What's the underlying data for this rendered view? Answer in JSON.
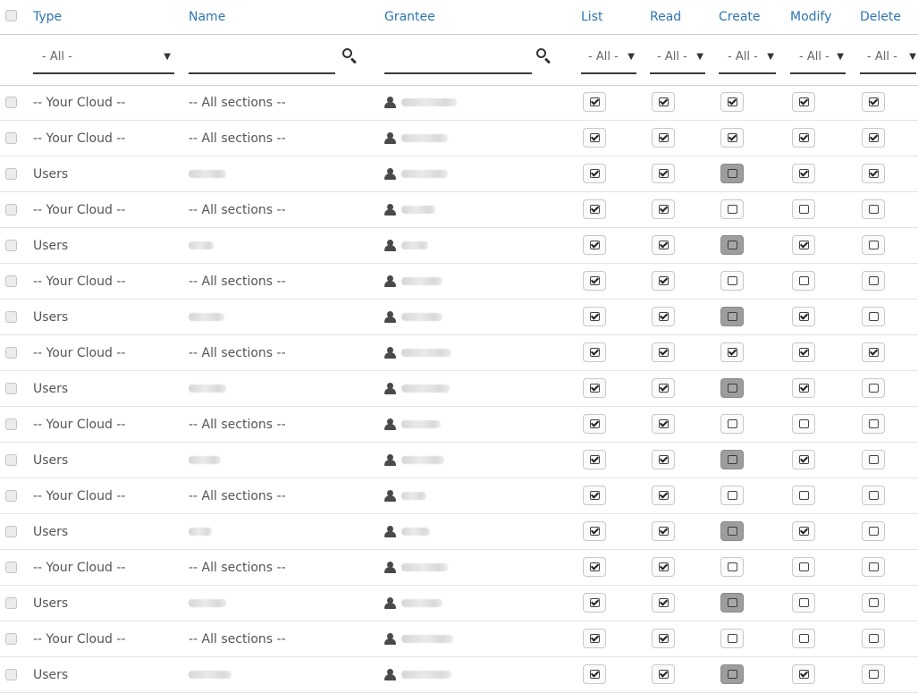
{
  "headers": {
    "type": "Type",
    "name": "Name",
    "grantee": "Grantee",
    "list": "List",
    "read": "Read",
    "create": "Create",
    "modify": "Modify",
    "delete": "Delete"
  },
  "filters": {
    "type_value": "- All -",
    "list_value": "- All -",
    "read_value": "- All -",
    "create_value": "- All -",
    "modify_value": "- All -",
    "delete_value": "- All -",
    "name_search_placeholder": "",
    "grantee_search_placeholder": ""
  },
  "rows": [
    {
      "type": "-- Your Cloud --",
      "name": "-- All sections --",
      "grantee": "",
      "list": true,
      "read": true,
      "create": true,
      "modify": true,
      "delete": true,
      "create_disabled": false
    },
    {
      "type": "-- Your Cloud --",
      "name": "-- All sections --",
      "grantee": "",
      "list": true,
      "read": true,
      "create": true,
      "modify": true,
      "delete": true,
      "create_disabled": false
    },
    {
      "type": "Users",
      "name": "",
      "grantee": "",
      "list": true,
      "read": true,
      "create": false,
      "modify": true,
      "delete": true,
      "create_disabled": true
    },
    {
      "type": "-- Your Cloud --",
      "name": "-- All sections --",
      "grantee": "",
      "list": true,
      "read": true,
      "create": false,
      "modify": false,
      "delete": false,
      "create_disabled": false
    },
    {
      "type": "Users",
      "name": "",
      "grantee": "",
      "list": true,
      "read": true,
      "create": false,
      "modify": true,
      "delete": false,
      "create_disabled": true
    },
    {
      "type": "-- Your Cloud --",
      "name": "-- All sections --",
      "grantee": "",
      "list": true,
      "read": true,
      "create": false,
      "modify": false,
      "delete": false,
      "create_disabled": false
    },
    {
      "type": "Users",
      "name": "",
      "grantee": "",
      "list": true,
      "read": true,
      "create": false,
      "modify": true,
      "delete": false,
      "create_disabled": true
    },
    {
      "type": "-- Your Cloud --",
      "name": "-- All sections --",
      "grantee": "",
      "list": true,
      "read": true,
      "create": true,
      "modify": true,
      "delete": true,
      "create_disabled": false
    },
    {
      "type": "Users",
      "name": "",
      "grantee": "",
      "list": true,
      "read": true,
      "create": false,
      "modify": true,
      "delete": false,
      "create_disabled": true
    },
    {
      "type": "-- Your Cloud --",
      "name": "-- All sections --",
      "grantee": "",
      "list": true,
      "read": true,
      "create": false,
      "modify": false,
      "delete": false,
      "create_disabled": false
    },
    {
      "type": "Users",
      "name": "",
      "grantee": "",
      "list": true,
      "read": true,
      "create": false,
      "modify": true,
      "delete": false,
      "create_disabled": true
    },
    {
      "type": "-- Your Cloud --",
      "name": "-- All sections --",
      "grantee": "",
      "list": true,
      "read": true,
      "create": false,
      "modify": false,
      "delete": false,
      "create_disabled": false
    },
    {
      "type": "Users",
      "name": "",
      "grantee": "",
      "list": true,
      "read": true,
      "create": false,
      "modify": true,
      "delete": false,
      "create_disabled": true
    },
    {
      "type": "-- Your Cloud --",
      "name": "-- All sections --",
      "grantee": "",
      "list": true,
      "read": true,
      "create": false,
      "modify": false,
      "delete": false,
      "create_disabled": false
    },
    {
      "type": "Users",
      "name": "",
      "grantee": "",
      "list": true,
      "read": true,
      "create": false,
      "modify": false,
      "delete": false,
      "create_disabled": true
    },
    {
      "type": "-- Your Cloud --",
      "name": "-- All sections --",
      "grantee": "",
      "list": true,
      "read": true,
      "create": false,
      "modify": false,
      "delete": false,
      "create_disabled": false
    },
    {
      "type": "Users",
      "name": "",
      "grantee": "",
      "list": true,
      "read": true,
      "create": false,
      "modify": true,
      "delete": false,
      "create_disabled": true
    }
  ],
  "colors": {
    "header_link": "#2f75b5",
    "disabled_box": "#9d9d9d"
  }
}
